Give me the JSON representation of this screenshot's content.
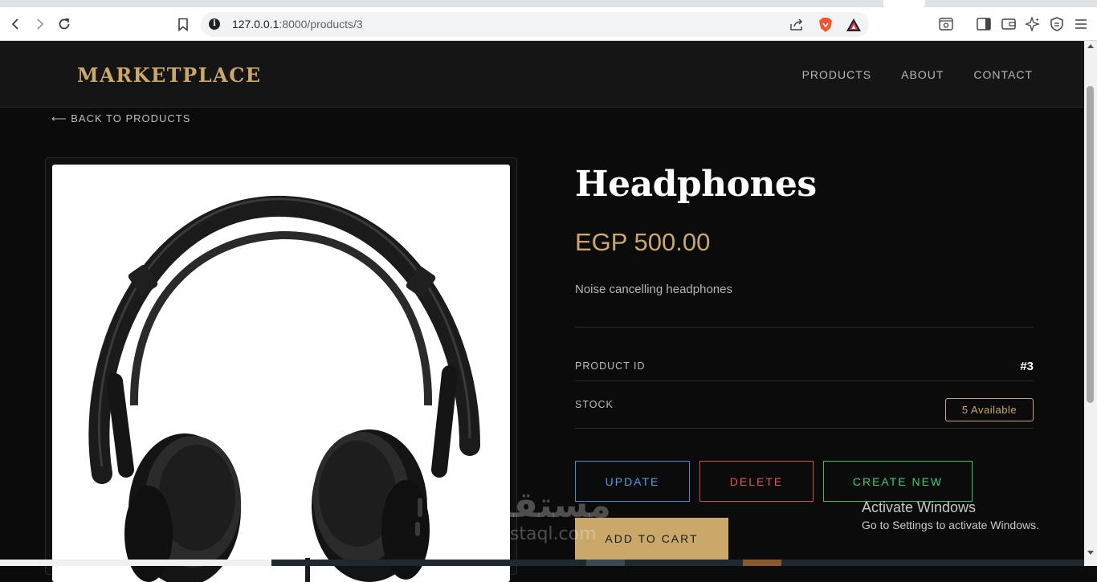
{
  "browser": {
    "url_host": "127.0.0.1",
    "url_rest": ":8000/products/3"
  },
  "header": {
    "brand": "MARKETPLACE",
    "nav": [
      "PRODUCTS",
      "ABOUT",
      "CONTACT"
    ]
  },
  "back_link": "⟵ BACK TO PRODUCTS",
  "product": {
    "name": "Headphones",
    "price": "EGP 500.00",
    "description": "Noise cancelling headphones",
    "id_label": "PRODUCT ID",
    "id_value": "#3",
    "stock_label": "STOCK",
    "stock_value": "5 Available"
  },
  "actions": {
    "update": "UPDATE",
    "delete": "DELETE",
    "create": "CREATE NEW",
    "add_to_cart": "ADD TO CART"
  },
  "watermark": {
    "arabic": "مستقل",
    "latin": "mostaql.com"
  },
  "windows_notice": {
    "title": "Activate Windows",
    "subtitle": "Go to Settings to activate Windows."
  },
  "colors": {
    "accent_gold": "#c9a86a",
    "update_blue": "#4aa0e8",
    "delete_red": "#e5593f",
    "create_green": "#36cf70"
  }
}
